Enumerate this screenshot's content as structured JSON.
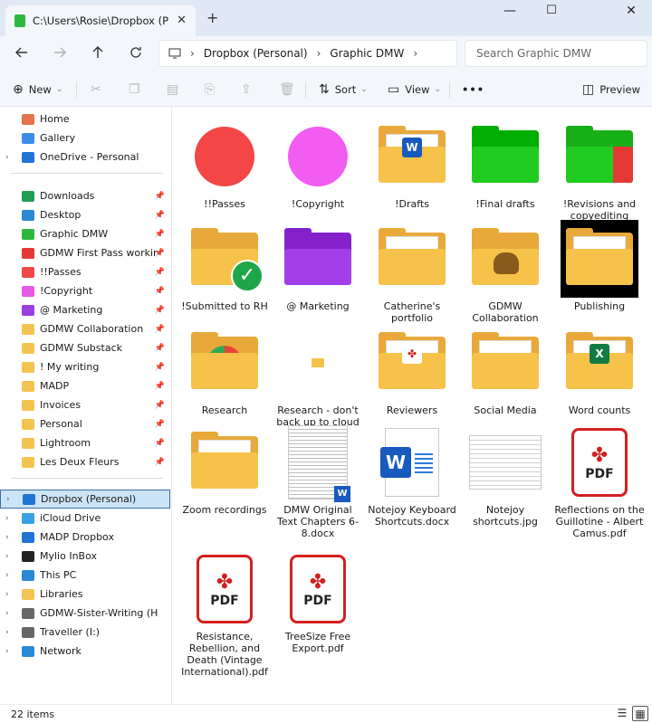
{
  "window": {
    "tab_title": "C:\\Users\\Rosie\\Dropbox (Personal)",
    "tab_close": "✕",
    "new_tab": "+",
    "minimize": "—",
    "maximize": "☐",
    "close": "✕"
  },
  "address": {
    "segments": [
      "Dropbox (Personal)",
      "Graphic DMW"
    ],
    "separator": "›",
    "search_placeholder": "Search Graphic DMW"
  },
  "toolbar": {
    "new_label": "New",
    "sort_label": "Sort",
    "view_label": "View",
    "more_label": "•••",
    "preview_label": "Preview"
  },
  "sidebar": {
    "top": [
      {
        "label": "Home",
        "color": "#e6734a",
        "chev": false
      },
      {
        "label": "Gallery",
        "color": "#3a8ee6",
        "chev": false
      },
      {
        "label": "OneDrive - Personal",
        "color": "#1f74d4",
        "chev": true
      }
    ],
    "pinned": [
      {
        "label": "Downloads",
        "color": "#1f9d55"
      },
      {
        "label": "Desktop",
        "color": "#2a88d8"
      },
      {
        "label": "Graphic DMW",
        "color": "#2db83d"
      },
      {
        "label": "GDMW First Pass working fol",
        "color": "#e53935"
      },
      {
        "label": "!!Passes",
        "color": "#f04848"
      },
      {
        "label": "!Copyright",
        "color": "#e659e6"
      },
      {
        "label": "@ Marketing",
        "color": "#9b3fe0"
      },
      {
        "label": "GDMW Collaboration",
        "color": "#f3c44f"
      },
      {
        "label": "GDMW Substack",
        "color": "#f3c44f"
      },
      {
        "label": "! My writing",
        "color": "#f3c44f"
      },
      {
        "label": "MADP",
        "color": "#f3c44f"
      },
      {
        "label": "Invoices",
        "color": "#f3c44f"
      },
      {
        "label": "Personal",
        "color": "#f3c44f"
      },
      {
        "label": "Lightroom",
        "color": "#f3c44f"
      },
      {
        "label": "Les Deux Fleurs",
        "color": "#f3c44f"
      }
    ],
    "drives": [
      {
        "label": "Dropbox (Personal)",
        "color": "#1f74d4",
        "selected": true
      },
      {
        "label": "iCloud Drive",
        "color": "#3aa0e6",
        "selected": false
      },
      {
        "label": "MADP Dropbox",
        "color": "#1f74d4",
        "selected": false
      },
      {
        "label": "Mylio InBox",
        "color": "#222222",
        "selected": false
      },
      {
        "label": "This PC",
        "color": "#2a88d8",
        "selected": false
      },
      {
        "label": "Libraries",
        "color": "#f3c44f",
        "selected": false
      },
      {
        "label": "GDMW-Sister-Writing (H:)",
        "color": "#666666",
        "selected": false
      },
      {
        "label": "Traveller (I:)",
        "color": "#666666",
        "selected": false
      },
      {
        "label": "Network",
        "color": "#2a88d8",
        "selected": false
      }
    ],
    "pin_glyph": "📌",
    "chev_glyph": "›"
  },
  "files": [
    {
      "label": "!!Passes",
      "kind": "circle",
      "color": "#f44646"
    },
    {
      "label": "!Copyright",
      "kind": "circle",
      "color": "#f25cf0"
    },
    {
      "label": "!Drafts",
      "kind": "folder-word",
      "color": "#f6c24a"
    },
    {
      "label": "!Final drafts",
      "kind": "folder",
      "color": "#1fcc1f"
    },
    {
      "label": "!Revisions and copyediting",
      "kind": "folder-red",
      "color": "#1fcc1f"
    },
    {
      "label": "!Submitted to RH",
      "kind": "folder-check",
      "color": "#f6c24a"
    },
    {
      "label": "@ Marketing",
      "kind": "folder",
      "color": "#a23fe8"
    },
    {
      "label": "Catherine's portfolio",
      "kind": "folder-paper",
      "color": "#f6c24a"
    },
    {
      "label": "GDMW Collaboration",
      "kind": "folder-group",
      "color": "#f6c24a"
    },
    {
      "label": "Publishing",
      "kind": "folder-black",
      "color": "#f6c24a"
    },
    {
      "label": "Research",
      "kind": "folder-chrome",
      "color": "#f6c24a"
    },
    {
      "label": "Research - don't back up to cloud",
      "kind": "mini-folder",
      "color": "#f6c24a"
    },
    {
      "label": "Reviewers",
      "kind": "folder-pdf",
      "color": "#f6c24a"
    },
    {
      "label": "Social Media",
      "kind": "folder-paper",
      "color": "#f6c24a"
    },
    {
      "label": "Word counts",
      "kind": "folder-excel",
      "color": "#f6c24a"
    },
    {
      "label": "Zoom recordings",
      "kind": "folder-paper",
      "color": "#f6c24a"
    },
    {
      "label": "DMW Original Text Chapters 6-8.docx",
      "kind": "doc-text",
      "color": "#ffffff"
    },
    {
      "label": "Notejoy Keyboard Shortcuts.docx",
      "kind": "word",
      "color": "#185abd"
    },
    {
      "label": "Notejoy shortcuts.jpg",
      "kind": "doc-jpg",
      "color": "#ffffff"
    },
    {
      "label": "Reflections on the Guillotine - Albert Camus.pdf",
      "kind": "pdf",
      "color": "#d32020"
    },
    {
      "label": "Resistance, Rebellion, and Death (Vintage International).pdf",
      "kind": "pdf",
      "color": "#d32020"
    },
    {
      "label": "TreeSize Free Export.pdf",
      "kind": "pdf",
      "color": "#d32020"
    }
  ],
  "icons": {
    "word_letter": "W",
    "excel_letter": "X",
    "pdf_text": "PDF",
    "pdf_swirl": "✤",
    "check": "✓"
  },
  "status": {
    "item_count": "22 items",
    "details_view": "☰",
    "large_icons_view": "▦"
  }
}
